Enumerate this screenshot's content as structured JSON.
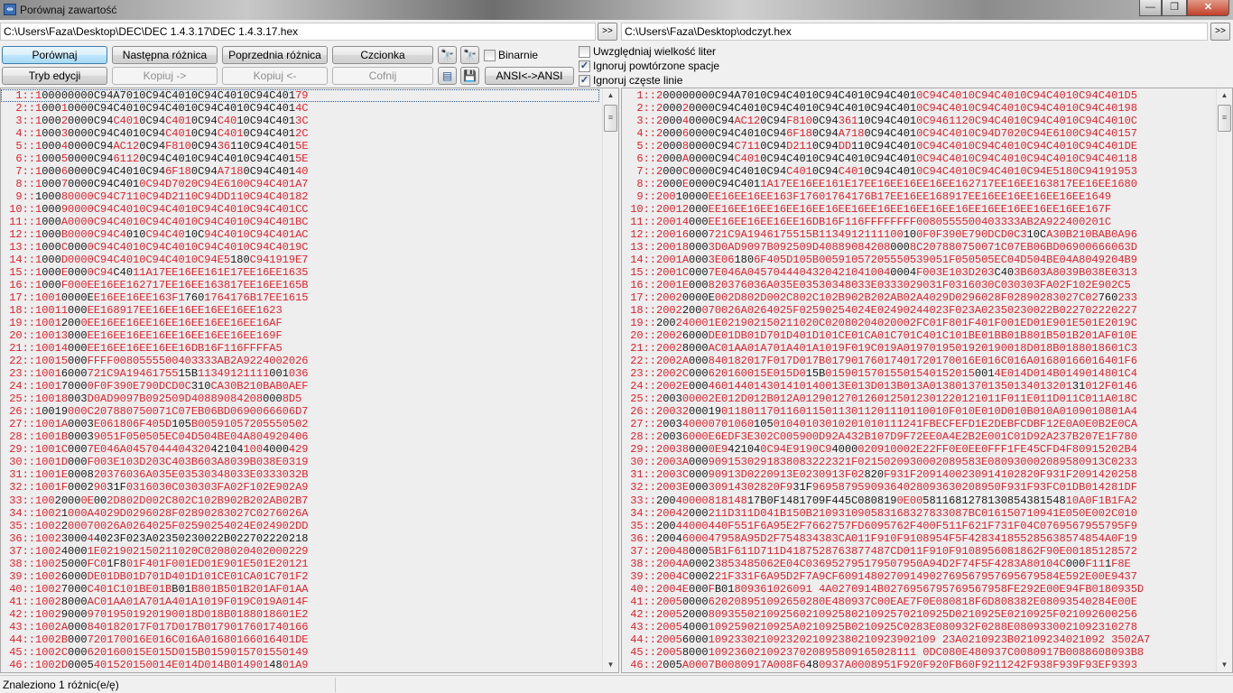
{
  "window": {
    "title": "Porównaj zawartość",
    "minimize": "—",
    "restore": "❐",
    "close": "✕"
  },
  "paths": {
    "left": "C:\\Users\\Faza\\Desktop\\DEC\\DEC 1.4.3.17\\DEC 1.4.3.17.hex",
    "right": "C:\\Users\\Faza\\Desktop\\odczyt.hex",
    "go_label": ">>"
  },
  "toolbar": {
    "compare": "Porównaj",
    "next_diff": "Następna różnica",
    "prev_diff": "Poprzednia różnica",
    "font": "Czcionka",
    "edit_mode": "Tryb edycji",
    "copy_right": "Kopiuj ->",
    "copy_left": "Kopiuj <-",
    "undo": "Cofnij",
    "ansi": "ANSI<->ANSI",
    "binary": {
      "label": "Binarnie",
      "checked": false
    }
  },
  "options": [
    {
      "label": "Uwzględniaj wielkość liter",
      "checked": false
    },
    {
      "label": "Ignoruj powtórzone spacje",
      "checked": true
    },
    {
      "label": "Ignoruj częste linie",
      "checked": true
    }
  ],
  "colors": {
    "diff": "#e3202b",
    "same": "#1a1a1a"
  },
  "left": {
    "lines": [
      [
        "1",
        "00000000C94A7010C94C4010C94C4010C94C401",
        "79"
      ],
      [
        "1",
        "000",
        "1",
        "0000C94C4010C94C4010C94C4010C94C401",
        "4C"
      ],
      [
        "1",
        "000",
        "2",
        "0000C94",
        "C401",
        "0C94",
        "C401",
        "0C94",
        "C40",
        "10C94C401",
        "3C"
      ],
      [
        "1",
        "000",
        "3",
        "0000C94C4010C94",
        "C401",
        "0C94",
        "C401",
        "0C94C401",
        "2C"
      ],
      [
        "1",
        "000",
        "4",
        "0000C94",
        "AC12",
        "0C94",
        "F810",
        "0C94",
        "36",
        "110C94C401",
        "5E"
      ],
      [
        "1",
        "000",
        "5",
        "0000C94",
        "6112",
        "0C94C4010C94C4010C94C401",
        "5E"
      ],
      [
        "1",
        "000",
        "6",
        "0000C94C4010C94",
        "6F18",
        "0C94",
        "A718",
        "0C94C401",
        "40"
      ],
      [
        "1",
        "000",
        "7",
        "0000C94C401",
        "0C94D7020C94E6100C94C401A7"
      ],
      [
        "",
        "1000",
        "80000C94C7110C94D2110C94DD110C94C40182"
      ],
      [
        "1",
        "000",
        "90000C94C4010C94C4010C94C4010C94C401CC"
      ],
      [
        "1",
        "000",
        "A0000C94C4010C94C4010C94C4010C94C401BC"
      ],
      [
        "1",
        "000",
        "B0000C94C4",
        "010",
        "C94C40",
        "10C",
        "94C4010C94C401AC"
      ],
      [
        "1",
        "000",
        "C",
        "000",
        "0C94C4010C94C4010C94C4010C94C4019C"
      ],
      [
        "1",
        "000",
        "D0000C94C4010C94C4010C94E5",
        "180",
        "C941919E7"
      ],
      [
        "1",
        "000",
        "E",
        "000",
        "0C94",
        "C40",
        "11A17EE16EE161E17EE16EE1635"
      ],
      [
        "1",
        "000",
        "F000EE16EE162717EE16EE163817EE16EE165B"
      ],
      [
        "1001",
        "0000E",
        "E16EE16EE163F1",
        "760",
        "1764176B17EE1615"
      ],
      [
        "10011",
        "000",
        "EE168917EE16EE16EE16EE16EE1623"
      ],
      [
        "1001",
        "200",
        "0EE16EE16EE16EE16EE16EE16EE16AF"
      ],
      [
        "10013",
        "000",
        "EE16EE16EE16EE16EE16EE16EE169F"
      ],
      [
        "10014",
        "000",
        "EE16EE16EE16EE16DB16F116FFFFA5"
      ],
      [
        "10015",
        "000",
        "FFFF0080555500403333AB2A9224002026"
      ],
      [
        "1001",
        "6000",
        "721C9A19461755",
        "15B",
        "11349121111",
        "001",
        "036"
      ],
      [
        "1001",
        "7000",
        "0F0F390E790DCD0C",
        "310",
        "CA30B210BAB0AEF"
      ],
      [
        "10018",
        "003",
        "D0AD9097B092509D40889084208",
        "000",
        "8D5"
      ],
      [
        "1",
        "0019",
        "000C207880750071C07EB06BD0690066606D7"
      ],
      [
        "1001A",
        "0003",
        "E061806F405D",
        "105",
        "B00591057205550502"
      ],
      [
        "1001B",
        "0003",
        "9051F050505EC04D504BE04A804920406"
      ],
      [
        "1001C",
        "000",
        "7E046A0457044404320",
        "42104",
        "100",
        "4000",
        "429"
      ],
      [
        "1001D",
        "000",
        "F003E103D203C403B603A8039B038E0319"
      ],
      [
        "1001E",
        "0008",
        "20376036A035E03530348033E0333032B"
      ],
      [
        "1001F",
        "0002",
        "90",
        "31F",
        "0316030C030303FA02F102E902A9"
      ],
      [
        "100",
        "2000",
        "0E",
        "00",
        "2D802D002C802C102B902B202AB02B7"
      ],
      [
        "1002",
        "1",
        "000A4029D0296028F02890283027C0276026A"
      ],
      [
        "1002",
        "2",
        "00070026A0264025F02590254024E024902DD"
      ],
      [
        "1002",
        "3000",
        "4",
        "4023F023A02350230022B022702220218"
      ],
      [
        "1002",
        "4000",
        "1E021902150211020C0208020402000229"
      ],
      [
        "1002",
        "5000",
        "FC0",
        "1F8",
        "01F401F001ED01E901E501E20121"
      ],
      [
        "1002",
        "6000",
        "DE01DB01D701D401D101CE01CA01C701F2"
      ],
      [
        "1002",
        "7000",
        "C401C101BE01B",
        "B01",
        "B801B501B201AF01AA"
      ],
      [
        "1002",
        "8000",
        "AC01AA01A701A401A1019F019C019A014F"
      ],
      [
        "1002",
        "9000",
        "97019501920190018D018B0188018601E2"
      ],
      [
        "1002A",
        "000",
        "840182017F017D017B0179017601740166"
      ],
      [
        "1002B",
        "000",
        "720170016E016C016A01680166016401DE"
      ],
      [
        "1002C",
        "000",
        "620160015E015D015B0159015701550149"
      ],
      [
        "1002D",
        "0005",
        "401520150014E014D014B014901",
        "48",
        "01A9"
      ]
    ]
  },
  "right": {
    "lines": [
      [
        "2",
        "00000000C94A7010C94C4010C94C4010C94C401",
        "0C94C4010C94C4010C94C4010C94C401D5"
      ],
      [
        "2",
        "000",
        "2",
        "0000C94C4010C94C4010C94C4010C94C401",
        "0C94C4010C94C4010C94C4010C94C40198"
      ],
      [
        "2",
        "000",
        "4",
        "0000C94",
        "AC12",
        "0C94",
        "F810",
        "0C94",
        "361",
        "10C94C401",
        "0C9461120C94C4010C94C4010C94C4010C"
      ],
      [
        "2",
        "000",
        "6",
        "0000C94C4010C94",
        "6F18",
        "0C94",
        "A718",
        "0C94C401",
        "0C94C4010C94D7020C94E6100C94C40157"
      ],
      [
        "2",
        "000",
        "8",
        "0000C94",
        "C711",
        "0C94",
        "D211",
        "0C94",
        "DD",
        "110C94C401",
        "0C94C4010C94C4010C94C4010C94C401DE"
      ],
      [
        "2",
        "000",
        "A",
        "0000C94",
        "C401",
        "0C94C4010C94C4010C94C401",
        "0C94C4010C94C4010C94C4010C94C40118"
      ],
      [
        "2",
        "000",
        "C",
        "0000C94C4010C94",
        "C401",
        "0C94",
        "C401",
        "0C94C401",
        "0C94C4010C94C4010C94E5180C94191953"
      ],
      [
        "2",
        "000",
        "E",
        "0000C94C401",
        "1A17EE16EE161E17EE16EE16EE16EE162717EE16EE163817EE16EE1680"
      ],
      [
        "200",
        "10000",
        "EE16EE16EE163F17601764176B17EE16EE168917EE16EE16EE16EE16EE1649"
      ],
      [
        "20012",
        "000",
        "EE16EE16EE16EE16EE16EE16EE16EE16EE16EE16EE16EE16EE16EE16EE167F"
      ],
      [
        "20014",
        "000",
        "EE16EE16EE16EE16DB16F116FFFFFFFF0080555500403333AB2A922400201C"
      ],
      [
        "20016",
        "000",
        "721C9A1946175515B1134912111100",
        "10",
        "0F0F390E790DCD0C3",
        "10C",
        "A30B210BAB0A96"
      ],
      [
        "20018",
        "000",
        "3D0AD9097B092509D40889084208",
        "000",
        "8C207880750071C07EB06BD06900666063D"
      ],
      [
        "2001A",
        "000",
        "3E06",
        "180",
        "6F405D105B00591057205550539051F050505EC04D504BE04A8049204B9"
      ],
      [
        "2001C",
        "000",
        "7E046A0457044404320421041004",
        "0004",
        "F003E103D203",
        "C40",
        "3B603A8039B038E0313"
      ],
      [
        "2001E",
        "000",
        "820376036A035E03530348033E0333029031F0316030C030303FA02F102E902C5"
      ],
      [
        "2002",
        "0000E",
        "002D802D002C802C102B902B202AB02A4029D0296028F02890283027C02",
        "760",
        "233"
      ],
      [
        "2002",
        "200",
        "070026A0264025F02590254024E02490244023F023A02350230022B022702220227"
      ],
      [
        "",
        "200",
        "240001E021902150211020C02080204020002FC01F801F401F001ED01E901E501E2019C"
      ],
      [
        "2002",
        "6000",
        "DE01DB01D701D401D101CE01CA01C701C401C101BE01BB01B801B501B201AF010E"
      ],
      [
        "2002",
        "8000",
        "AC01AA01A701A401A1019F019C019A0197019501920190018D018B0188018601C3"
      ],
      [
        "2002A",
        "000",
        "840182017F017D017B01790176017401720170016E016C016A01680166016401F6"
      ],
      [
        "2002C",
        "000",
        "620160015E015D0",
        "15B",
        "01590157015501540152015",
        "001",
        "4E014D014B0149014801C4"
      ],
      [
        "2002E",
        "000",
        "460144014301410140013E013D013B013A0138013701350134013201",
        "31",
        "012F0146"
      ],
      [
        "2",
        "003",
        "00002E012D012B012A0129012701260125012301220121011F011E011D011C011A018C"
      ],
      [
        "20032",
        "00019",
        "01180117011601150113011201110110010F010E010D010B010A0109010801A4"
      ],
      [
        "2",
        "003",
        "40000701060",
        "105",
        "01040103010201010111241FBECFEFD1E2DEBFCDBF12E0A0E0B2E0CA"
      ],
      [
        "2",
        "003",
        "6000E6EDF3E302C005900D92A432B107D9F72EE0A4E2B2E001C01D92A237B207E1F780"
      ],
      [
        "20038",
        "000",
        "0E9",
        "42104",
        "0C94E9190C9",
        "4000",
        "020910002E22FF0E0EE0FFF1FE45CFD4F80915202B4"
      ],
      [
        "2003A",
        "000",
        "9091530291838083222321F0215020930002089583E080930002089580913C0233"
      ],
      [
        "2003C",
        "000",
        "90913D0220913E0230913F02",
        "820",
        "F931F2091400230914102820F931F2091420258"
      ],
      [
        "2003E",
        "000",
        "30914302820F9",
        "31F",
        "96958795909364028093630208950F931F93FC01DB014281DF"
      ],
      [
        "",
        "200",
        "40000818148",
        "17B0F1481709F445C080819",
        "0E00",
        "5811681278130854381548",
        "10A0F1B1FA2"
      ],
      [
        "20042",
        "000",
        "211D311D041B150B210931090583168327833087BC016150710941E050E002C010"
      ],
      [
        "",
        "200",
        "44000440F551F6A95E2F7662757FD6095762F400F511F621F731F04C0769567955795F9"
      ],
      [
        "",
        "2004",
        "600047958A95D2F754834383CA011F910F9108954F5F428341855285638574854A0F19"
      ],
      [
        "20048",
        "000",
        "5B1F611D711D4187528763877487CD011F910F9108956081862F90E00185128572"
      ],
      [
        "2004A",
        "0002",
        "3853485062E04C036952795179507950A94D2F74F5F4283A80104C",
        "000",
        "F11",
        "1",
        "F8E"
      ],
      [
        "2004C",
        "0002",
        "21F331F6A95D2F7A9CF6091480270914902769567957695679584E592E00E9437"
      ],
      [
        "2004E",
        "000",
        "F",
        "B01",
        "809361026091 4A0270914B0276956795769567958FE292E00E94FB0180935D"
      ],
      [
        "2005",
        "0000",
        "620208951092650280E480937C00EAE7F0E080818F6D808382E08093540284E00E"
      ],
      [
        "2005",
        "2000",
        "8093550210925602109258021092570210925D0210925E0210925F021092600256"
      ],
      [
        "2005",
        "4000",
        "1092590210925A0210925B0210925C0283E080932F0288E0809330021092310278"
      ],
      [
        "2005",
        "6000",
        "10923302109232021092380210923902109 23A0210923B02109234021092 3502A7"
      ],
      [
        "2005",
        "8000",
        "10923602109237020895809165028111 0DC080E480937C0080917B0088608093B8"
      ],
      [
        "2",
        "005",
        "A0007B0080917A008F6",
        "48",
        "0937A0008951F920F920FB60F9211242F938F939F93EF9393"
      ]
    ]
  },
  "status": {
    "text": "Znaleziono 1 różnic(e/ę)"
  }
}
